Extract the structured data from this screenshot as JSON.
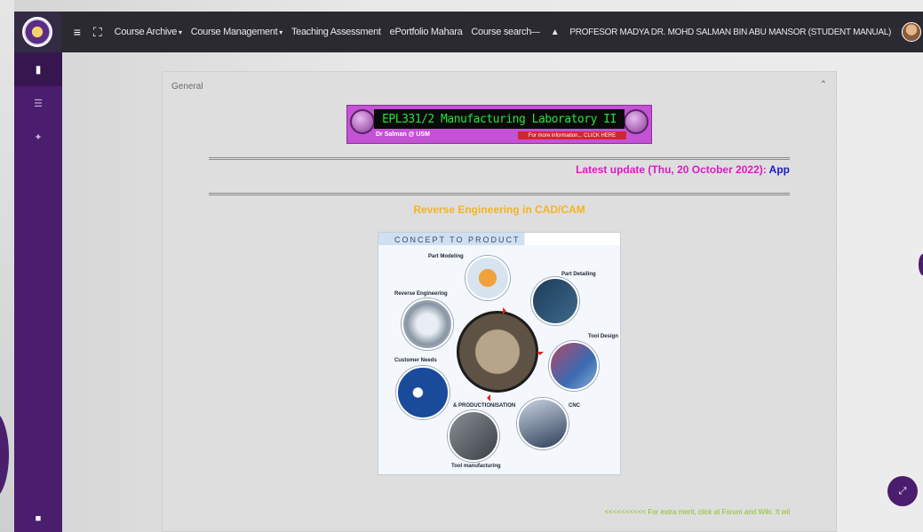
{
  "topbar": {
    "menu_icon": "hamburger-icon",
    "fullscreen_icon": "expand-icon",
    "nav": [
      {
        "label": "Course Archive",
        "dropdown": true
      },
      {
        "label": "Course Management",
        "dropdown": true
      },
      {
        "label": "Teaching Assessment",
        "dropdown": false
      },
      {
        "label": "ePortfolio Mahara",
        "dropdown": false
      },
      {
        "label": "Course search",
        "dropdown": false
      }
    ],
    "user_name": "PROFESOR MADYA DR. MOHD SALMAN BIN ABU MANSOR (STUDENT MANUAL)"
  },
  "sidebar": {
    "items": [
      "book-icon",
      "list-icon",
      "link-icon"
    ],
    "bottom": "square-icon"
  },
  "section": {
    "title": "General",
    "banner": {
      "course_title": "EPL331/2 Manufacturing Laboratory II",
      "credit": "Dr Salman @ USM",
      "more_link": "For more information... CLICK HERE"
    },
    "latest_update_label": "Latest update (Thu, 20 October 2022): ",
    "latest_update_trail": "App",
    "heading": "Reverse Engineering in CAD/CAM",
    "diagram": {
      "title": "CONCEPT TO PRODUCT",
      "labels": {
        "part_modeling": "Part Modeling",
        "part_detailing": "Part Detailing",
        "reverse_engineering": "Reverse Engineering",
        "tool_design": "Tool Design",
        "customer_needs": "Customer Needs",
        "productionisation": "& PRODUCTIONISATION",
        "cnc": "CNC",
        "tool_manufacturing": "Tool manufacturing"
      }
    },
    "footer_note": "<<<<<<<<<< For extra merit, click at Forum and Wiki. It wil"
  },
  "colors": {
    "topbar": "#2b2a30",
    "sidebar": "#4a1d6e",
    "latest_label": "#d91cc4",
    "heading": "#f5b323",
    "footer_note": "#8bc21c"
  }
}
